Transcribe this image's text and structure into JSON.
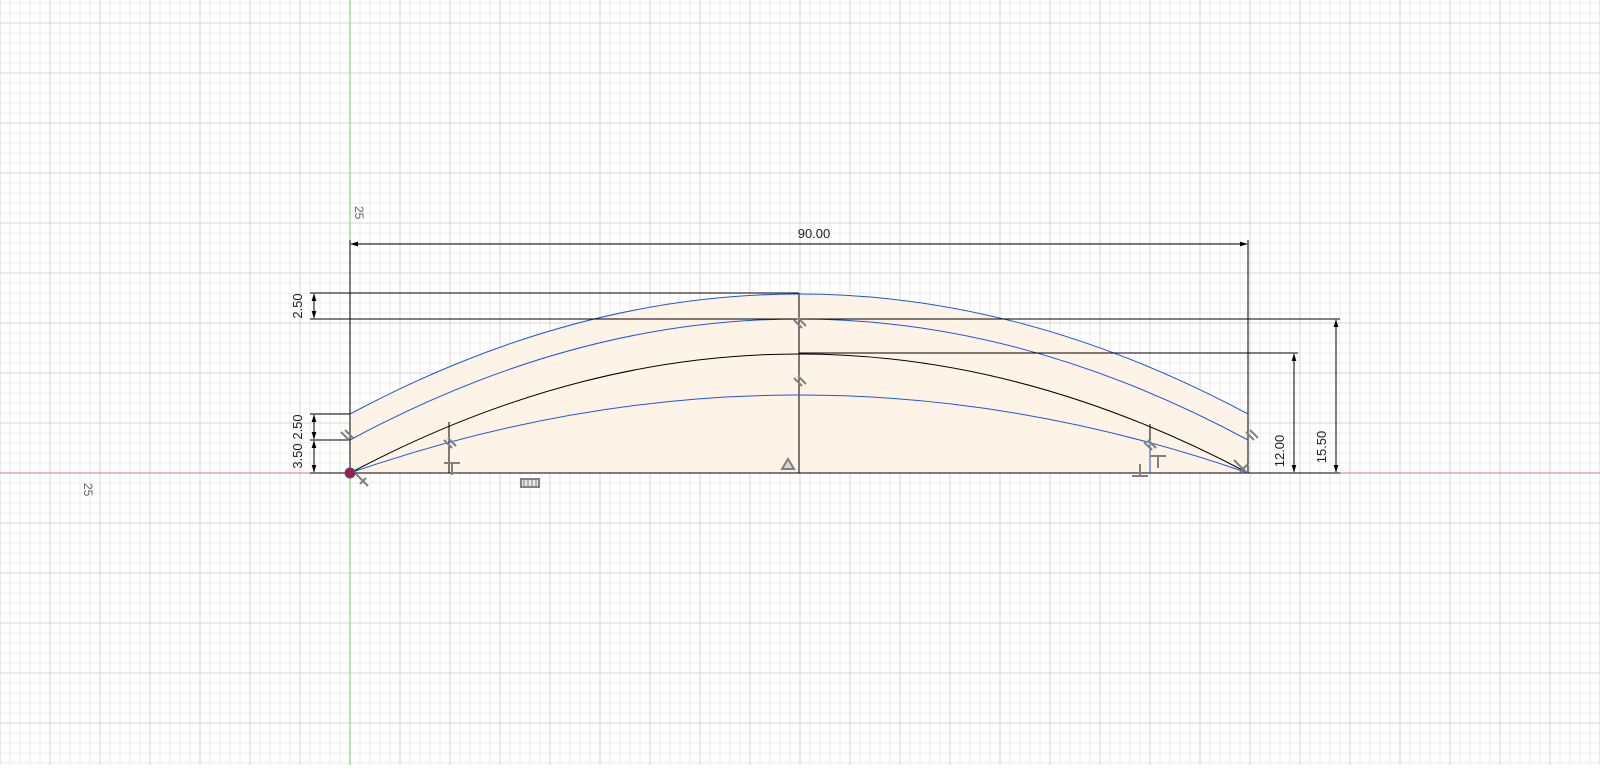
{
  "canvas": {
    "background": "#ffffff",
    "minor_grid_color": "#ebebeb",
    "major_grid_color": "#d6d6d6",
    "x_axis_color": "#e87070",
    "y_axis_color": "#7ac87a",
    "profile_fill": "#fdf3e6",
    "construction_color": "#2255dd",
    "sketch_line_color": "#000000",
    "dimension_color": "#000000",
    "constraint_icon_color": "#808080",
    "origin_point_color": "#9b1b5a"
  },
  "axis_labels": {
    "y_axis_tick": "25",
    "x_axis_tick": "25"
  },
  "dimensions": {
    "overall_width": "90.00",
    "top_offset": "2.50",
    "lower_offset_a": "2.50",
    "lower_offset_b": "3.50",
    "arc_height": "12.00",
    "total_height": "15.50"
  },
  "constraints": [
    {
      "name": "parallel-icon",
      "glyph": "//"
    },
    {
      "name": "perpendicular-icon",
      "glyph": "⊥"
    },
    {
      "name": "midpoint-icon",
      "glyph": "△"
    },
    {
      "name": "fix-icon",
      "glyph": "▤"
    }
  ]
}
